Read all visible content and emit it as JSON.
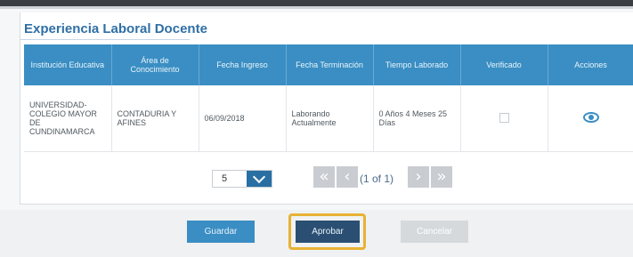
{
  "section": {
    "title": "Experiencia Laboral Docente"
  },
  "table": {
    "headers": [
      "Institución Educativa",
      "Área de Conocimiento",
      "Fecha Ingreso",
      "Fecha Terminación",
      "Tiempo Laborado",
      "Verificado",
      "Acciones"
    ],
    "rows": [
      {
        "institucion": "UNIVERSIDAD-COLEGIO MAYOR DE CUNDINAMARCA",
        "area": "CONTADURIA Y AFINES",
        "fecha_ingreso": "06/09/2018",
        "fecha_terminacion": "Laborando Actualmente",
        "tiempo": "0 Años 4 Meses 25 Días",
        "verificado": false,
        "accion_icon": "eye-icon"
      }
    ]
  },
  "paginator": {
    "rows_per_page": "5",
    "report": "(1 of 1)"
  },
  "actions": {
    "guardar": "Guardar",
    "aprobar": "Aprobar",
    "cancelar": "Cancelar"
  },
  "colors": {
    "header_bg": "#3a8ec3",
    "title": "#2f6fa5",
    "highlight": "#e7b234"
  }
}
